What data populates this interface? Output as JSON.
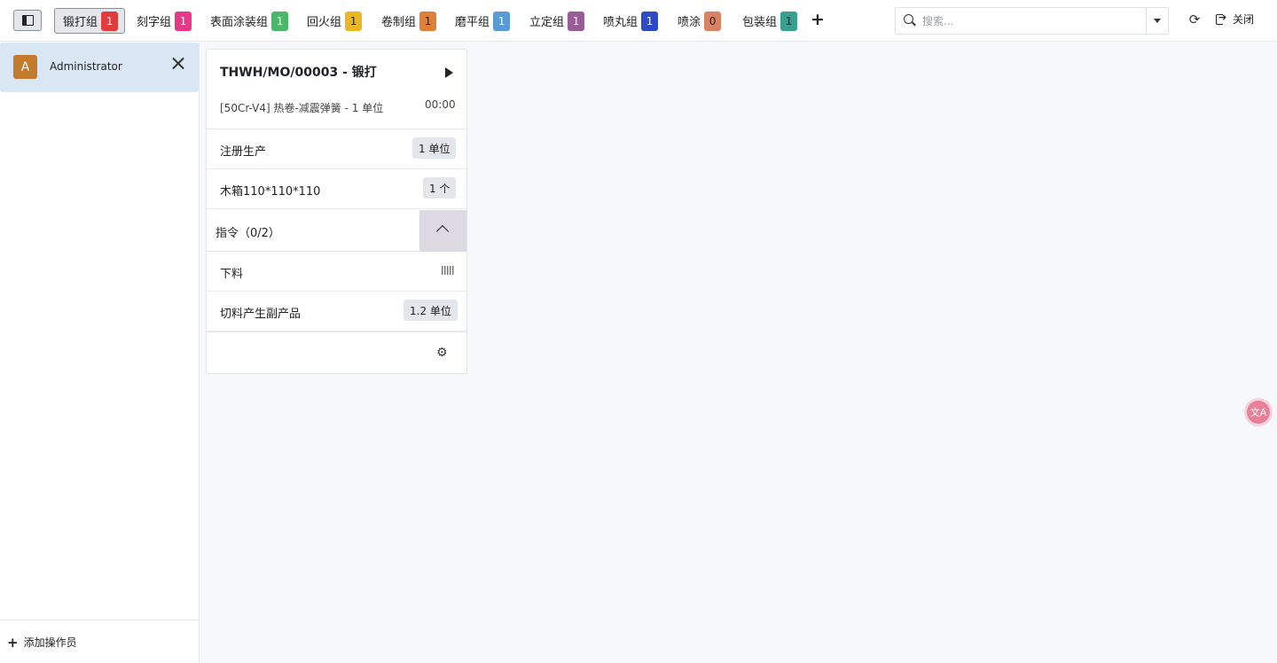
{
  "tabs": [
    {
      "label": "锻打组",
      "count": "1",
      "color": "#e23b3b",
      "active": true
    },
    {
      "label": "刻字组",
      "count": "1",
      "color": "#e53988"
    },
    {
      "label": "表面涂装组",
      "count": "1",
      "color": "#4cb76a"
    },
    {
      "label": "回火组",
      "count": "1",
      "color": "#e8b726"
    },
    {
      "label": "卷制组",
      "count": "1",
      "color": "#e27f36"
    },
    {
      "label": "磨平组",
      "count": "1",
      "color": "#5b9bd5"
    },
    {
      "label": "立定组",
      "count": "1",
      "color": "#9a5c96"
    },
    {
      "label": "喷丸组",
      "count": "1",
      "color": "#2d4bc4"
    },
    {
      "label": "喷涂",
      "count": "0",
      "color": "#d68263"
    },
    {
      "label": "包装组",
      "count": "1",
      "color": "#3a9e8f"
    }
  ],
  "add_tab_glyph": "+",
  "search": {
    "placeholder": "搜索..."
  },
  "refresh_glyph": "⟳",
  "close_label": "关闭",
  "sidebar": {
    "operator": {
      "initial": "A",
      "name": "Administrator"
    },
    "add_operator_label": "添加操作员"
  },
  "card": {
    "title": "THWH/MO/00003 - 锻打",
    "product": "[50Cr-V4] 热卷-减震弹簧 - 1 单位",
    "timer": "00:00",
    "rows": [
      {
        "label": "注册生产",
        "value": "1 单位"
      },
      {
        "label": "木箱110*110*110",
        "value": "1 个"
      }
    ],
    "instructions_label": "指令（0/2）",
    "steps": [
      {
        "label": "下料",
        "value": ""
      },
      {
        "label": "切料产生副产品",
        "value": "1.2 单位"
      }
    ],
    "gear_glyph": "⚙"
  },
  "translate_glyph": "文A"
}
